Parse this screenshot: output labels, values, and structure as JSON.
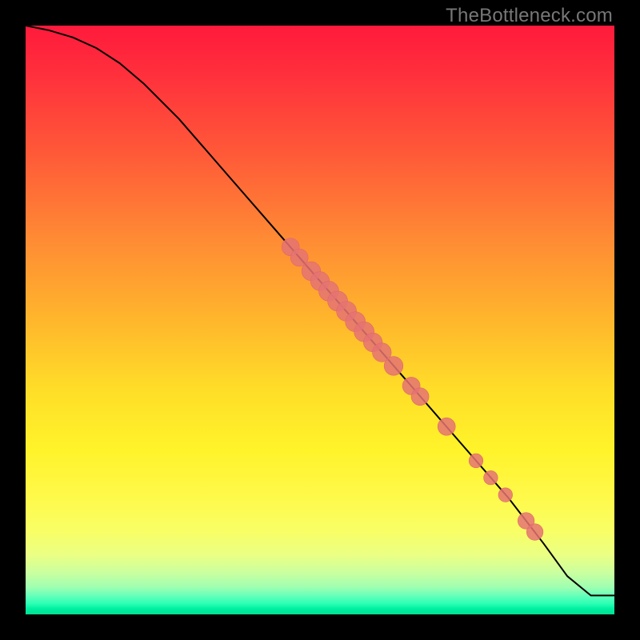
{
  "attribution": "TheBottleneck.com",
  "colors": {
    "marker": "#e57373",
    "line": "#000000",
    "background_black": "#000000"
  },
  "chart_data": {
    "type": "line",
    "title": "",
    "xlabel": "",
    "ylabel": "",
    "xlim": [
      0,
      100
    ],
    "ylim": [
      0,
      100
    ],
    "grid": false,
    "line": {
      "comment": "x as % across plot width (0=left), y as 100=top, 0=bottom of gradient area. Curve starts top-left, shallow, then near-linear diagonal to lower-right, then flat tail near bottom right.",
      "x": [
        0,
        4,
        8,
        12,
        16,
        20,
        26,
        34,
        42,
        50,
        58,
        66,
        74,
        82,
        88,
        92,
        96,
        100
      ],
      "y": [
        100,
        99.2,
        98.0,
        96.2,
        93.6,
        90.2,
        84.2,
        75.0,
        65.8,
        56.6,
        47.4,
        38.2,
        29.0,
        19.8,
        12.0,
        6.5,
        3.2,
        3.2
      ]
    },
    "markers": {
      "comment": "Clustered marker positions along the diagonal portion of the curve. Same coordinate convention as line. r is marker radius in % of plot width.",
      "points": [
        {
          "x": 45.0,
          "y": 62.4,
          "r": 1.5
        },
        {
          "x": 46.5,
          "y": 60.6,
          "r": 1.5
        },
        {
          "x": 48.5,
          "y": 58.3,
          "r": 1.6
        },
        {
          "x": 50.0,
          "y": 56.6,
          "r": 1.6
        },
        {
          "x": 51.5,
          "y": 54.9,
          "r": 1.7
        },
        {
          "x": 53.0,
          "y": 53.2,
          "r": 1.7
        },
        {
          "x": 54.5,
          "y": 51.5,
          "r": 1.7
        },
        {
          "x": 56.0,
          "y": 49.7,
          "r": 1.7
        },
        {
          "x": 57.5,
          "y": 48.0,
          "r": 1.7
        },
        {
          "x": 59.0,
          "y": 46.2,
          "r": 1.6
        },
        {
          "x": 60.5,
          "y": 44.5,
          "r": 1.6
        },
        {
          "x": 62.5,
          "y": 42.2,
          "r": 1.6
        },
        {
          "x": 65.5,
          "y": 38.8,
          "r": 1.5
        },
        {
          "x": 67.0,
          "y": 37.0,
          "r": 1.5
        },
        {
          "x": 71.5,
          "y": 31.9,
          "r": 1.5
        },
        {
          "x": 76.5,
          "y": 26.1,
          "r": 1.2
        },
        {
          "x": 79.0,
          "y": 23.2,
          "r": 1.2
        },
        {
          "x": 81.5,
          "y": 20.3,
          "r": 1.2
        },
        {
          "x": 85.0,
          "y": 15.9,
          "r": 1.4
        },
        {
          "x": 86.5,
          "y": 14.0,
          "r": 1.4
        }
      ]
    }
  }
}
